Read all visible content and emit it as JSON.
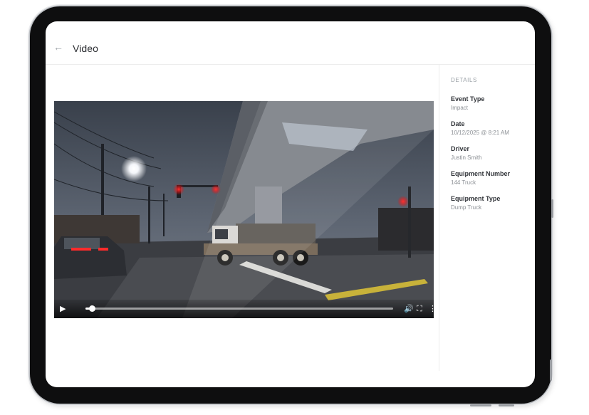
{
  "header": {
    "title": "Video",
    "back_icon": "arrow-left-icon"
  },
  "details": {
    "heading": "DETAILS",
    "items": [
      {
        "label": "Event Type",
        "value": "Impact"
      },
      {
        "label": "Date",
        "value": "10/12/2025 @ 8:21 AM"
      },
      {
        "label": "Driver",
        "value": "Justin Smith"
      },
      {
        "label": "Equipment Number",
        "value": "144 Truck"
      },
      {
        "label": "Equipment Type",
        "value": "Dump Truck"
      }
    ]
  },
  "video": {
    "progress": 0.02,
    "icons": [
      "play-icon",
      "volume-icon",
      "fullscreen-icon",
      "more-vertical-icon"
    ]
  }
}
